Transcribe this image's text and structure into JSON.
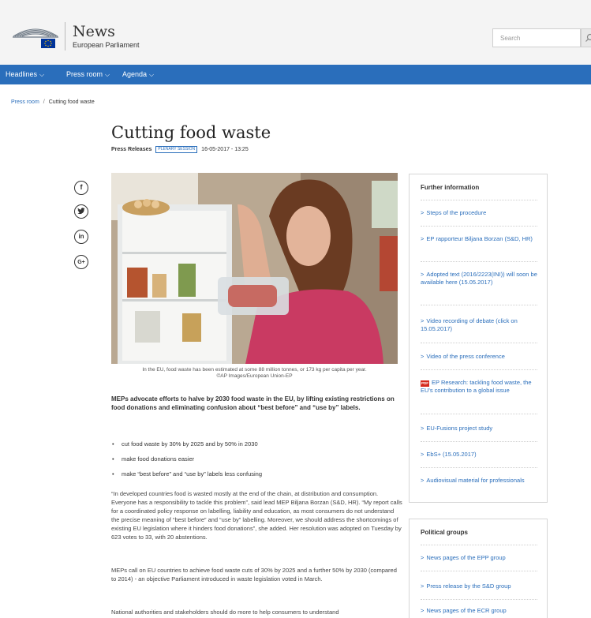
{
  "header": {
    "title": "News",
    "subtitle": "European Parliament",
    "search_placeholder": "Search"
  },
  "nav": {
    "items": [
      {
        "label": "Headlines"
      },
      {
        "label": "Press room"
      },
      {
        "label": "Agenda"
      }
    ]
  },
  "breadcrumb": {
    "items": [
      "Press room",
      "Cutting food waste"
    ]
  },
  "article": {
    "title": "Cutting food waste",
    "type": "Press Releases",
    "badge": "PLENARY SESSION",
    "datetime": "16-05-2017 - 13:25",
    "caption_line1": "In the EU, food waste has been estimated at some 88 million tonnes, or 173 kg per capita per year.",
    "caption_line2": "©AP Images/European Union-EP",
    "lead": "MEPs advocate efforts to halve by 2030 food waste in the EU, by lifting existing restrictions on food donations and eliminating confusion about “best before” and “use by” labels.",
    "bullets": [
      "cut food waste by 30% by 2025 and by 50% in 2030",
      "make food donations easier",
      "make “best before” and “use by” labels less confusing"
    ],
    "paragraphs": [
      "“In developed countries food is wasted mostly at the end of the chain, at distribution and consumption. Everyone has a responsibility to tackle this problem”, said lead MEP Biljana Borzan (S&D, HR). “My report calls for a coordinated policy response on labelling, liability and education, as most consumers do not understand the precise meaning of “best before” and “use by” labelling. Moreover, we should address the shortcomings of existing EU legislation where it hinders food donations”, she added. Her resolution was adopted on Tuesday by 623 votes to 33, with 20 abstentions.",
      "MEPs call on EU countries to achieve food waste cuts of 30% by 2025 and a further 50% by 2030 (compared to 2014) - an objective Parliament introduced in waste legislation voted in March.",
      "National authorities and stakeholders should do more to help consumers to understand"
    ]
  },
  "further_info": {
    "title": "Further information",
    "links": [
      "Steps of the procedure",
      "EP rapporteur Biljana Borzan (S&D, HR)",
      "Adopted text (2016/2223(INI)) will soon be available here (15.05.2017)",
      "Video recording of debate (click on 15.05.2017)",
      "Video of the press conference",
      "EP Research: tackling food waste, the EU's contribution to a global issue",
      "EU-Fusions project study",
      "EbS+ (15.05.2017)",
      "Audiovisual material for professionals"
    ],
    "pdf_label": "PDF"
  },
  "political_groups": {
    "title": "Political groups",
    "links": [
      "News pages of the EPP group",
      "Press release by the S&D group",
      "News pages of the ECR group"
    ]
  },
  "social": {
    "facebook": "f",
    "linkedin": "in",
    "googleplus": "G+"
  },
  "colors": {
    "accent": "#2a6ebb",
    "pdf": "#d52b1e",
    "topbar": "#f4f4f4"
  }
}
